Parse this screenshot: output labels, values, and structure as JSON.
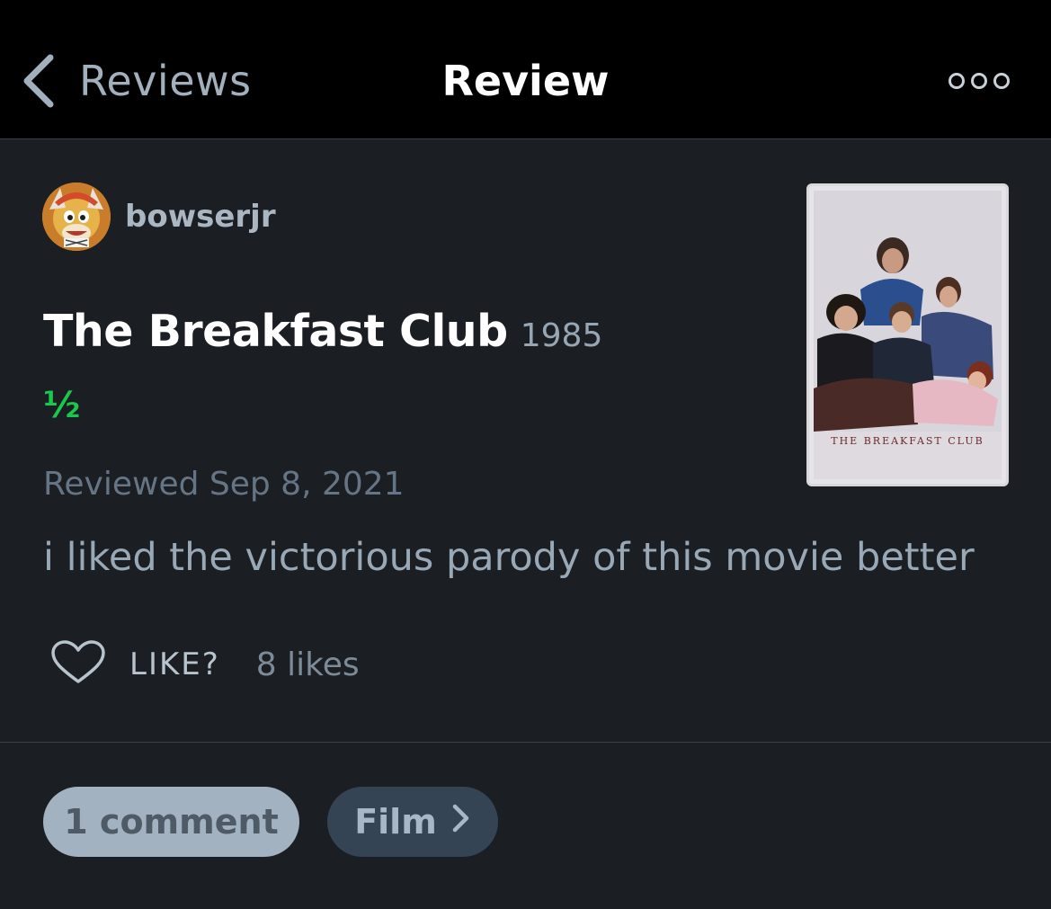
{
  "nav": {
    "back_label": "Reviews",
    "title": "Review",
    "back_icon": "chevron-left-icon",
    "more_icon": "more-dots-icon"
  },
  "author": {
    "username": "bowserjr",
    "avatar_icon": "avatar"
  },
  "film": {
    "title": "The Breakfast Club",
    "year": "1985",
    "rating": "½",
    "poster_caption": "THE BREAKFAST CLUB"
  },
  "review": {
    "reviewed_label": "Reviewed Sep 8, 2021",
    "text": "i liked the victorious parody of this movie better"
  },
  "actions": {
    "like_label": "LIKE?",
    "likes_count": "8 likes",
    "heart_icon": "heart-outline-icon"
  },
  "footer": {
    "comments_label": "1 comment",
    "film_label": "Film"
  },
  "colors": {
    "background": "#1b1e23",
    "navbar": "#000000",
    "rating_green": "#19c84c",
    "comment_pill": "#a3b2c1",
    "film_pill": "#344454"
  }
}
